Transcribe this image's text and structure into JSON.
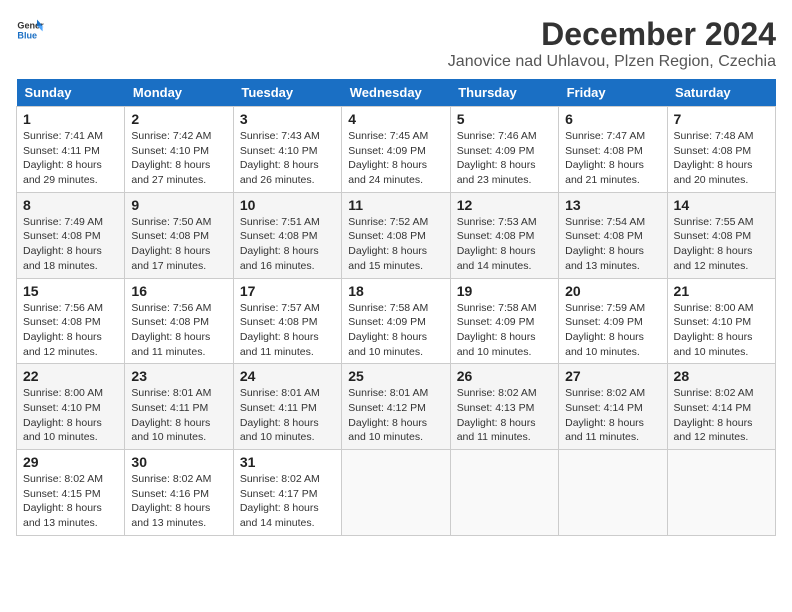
{
  "logo": {
    "general": "General",
    "blue": "Blue"
  },
  "header": {
    "title": "December 2024",
    "subtitle": "Janovice nad Uhlavou, Plzen Region, Czechia"
  },
  "weekdays": [
    "Sunday",
    "Monday",
    "Tuesday",
    "Wednesday",
    "Thursday",
    "Friday",
    "Saturday"
  ],
  "weeks": [
    [
      {
        "day": "1",
        "sunrise": "7:41 AM",
        "sunset": "4:11 PM",
        "daylight": "8 hours and 29 minutes."
      },
      {
        "day": "2",
        "sunrise": "7:42 AM",
        "sunset": "4:10 PM",
        "daylight": "8 hours and 27 minutes."
      },
      {
        "day": "3",
        "sunrise": "7:43 AM",
        "sunset": "4:10 PM",
        "daylight": "8 hours and 26 minutes."
      },
      {
        "day": "4",
        "sunrise": "7:45 AM",
        "sunset": "4:09 PM",
        "daylight": "8 hours and 24 minutes."
      },
      {
        "day": "5",
        "sunrise": "7:46 AM",
        "sunset": "4:09 PM",
        "daylight": "8 hours and 23 minutes."
      },
      {
        "day": "6",
        "sunrise": "7:47 AM",
        "sunset": "4:08 PM",
        "daylight": "8 hours and 21 minutes."
      },
      {
        "day": "7",
        "sunrise": "7:48 AM",
        "sunset": "4:08 PM",
        "daylight": "8 hours and 20 minutes."
      }
    ],
    [
      {
        "day": "8",
        "sunrise": "7:49 AM",
        "sunset": "4:08 PM",
        "daylight": "8 hours and 18 minutes."
      },
      {
        "day": "9",
        "sunrise": "7:50 AM",
        "sunset": "4:08 PM",
        "daylight": "8 hours and 17 minutes."
      },
      {
        "day": "10",
        "sunrise": "7:51 AM",
        "sunset": "4:08 PM",
        "daylight": "8 hours and 16 minutes."
      },
      {
        "day": "11",
        "sunrise": "7:52 AM",
        "sunset": "4:08 PM",
        "daylight": "8 hours and 15 minutes."
      },
      {
        "day": "12",
        "sunrise": "7:53 AM",
        "sunset": "4:08 PM",
        "daylight": "8 hours and 14 minutes."
      },
      {
        "day": "13",
        "sunrise": "7:54 AM",
        "sunset": "4:08 PM",
        "daylight": "8 hours and 13 minutes."
      },
      {
        "day": "14",
        "sunrise": "7:55 AM",
        "sunset": "4:08 PM",
        "daylight": "8 hours and 12 minutes."
      }
    ],
    [
      {
        "day": "15",
        "sunrise": "7:56 AM",
        "sunset": "4:08 PM",
        "daylight": "8 hours and 12 minutes."
      },
      {
        "day": "16",
        "sunrise": "7:56 AM",
        "sunset": "4:08 PM",
        "daylight": "8 hours and 11 minutes."
      },
      {
        "day": "17",
        "sunrise": "7:57 AM",
        "sunset": "4:08 PM",
        "daylight": "8 hours and 11 minutes."
      },
      {
        "day": "18",
        "sunrise": "7:58 AM",
        "sunset": "4:09 PM",
        "daylight": "8 hours and 10 minutes."
      },
      {
        "day": "19",
        "sunrise": "7:58 AM",
        "sunset": "4:09 PM",
        "daylight": "8 hours and 10 minutes."
      },
      {
        "day": "20",
        "sunrise": "7:59 AM",
        "sunset": "4:09 PM",
        "daylight": "8 hours and 10 minutes."
      },
      {
        "day": "21",
        "sunrise": "8:00 AM",
        "sunset": "4:10 PM",
        "daylight": "8 hours and 10 minutes."
      }
    ],
    [
      {
        "day": "22",
        "sunrise": "8:00 AM",
        "sunset": "4:10 PM",
        "daylight": "8 hours and 10 minutes."
      },
      {
        "day": "23",
        "sunrise": "8:01 AM",
        "sunset": "4:11 PM",
        "daylight": "8 hours and 10 minutes."
      },
      {
        "day": "24",
        "sunrise": "8:01 AM",
        "sunset": "4:11 PM",
        "daylight": "8 hours and 10 minutes."
      },
      {
        "day": "25",
        "sunrise": "8:01 AM",
        "sunset": "4:12 PM",
        "daylight": "8 hours and 10 minutes."
      },
      {
        "day": "26",
        "sunrise": "8:02 AM",
        "sunset": "4:13 PM",
        "daylight": "8 hours and 11 minutes."
      },
      {
        "day": "27",
        "sunrise": "8:02 AM",
        "sunset": "4:14 PM",
        "daylight": "8 hours and 11 minutes."
      },
      {
        "day": "28",
        "sunrise": "8:02 AM",
        "sunset": "4:14 PM",
        "daylight": "8 hours and 12 minutes."
      }
    ],
    [
      {
        "day": "29",
        "sunrise": "8:02 AM",
        "sunset": "4:15 PM",
        "daylight": "8 hours and 13 minutes."
      },
      {
        "day": "30",
        "sunrise": "8:02 AM",
        "sunset": "4:16 PM",
        "daylight": "8 hours and 13 minutes."
      },
      {
        "day": "31",
        "sunrise": "8:02 AM",
        "sunset": "4:17 PM",
        "daylight": "8 hours and 14 minutes."
      },
      null,
      null,
      null,
      null
    ]
  ]
}
